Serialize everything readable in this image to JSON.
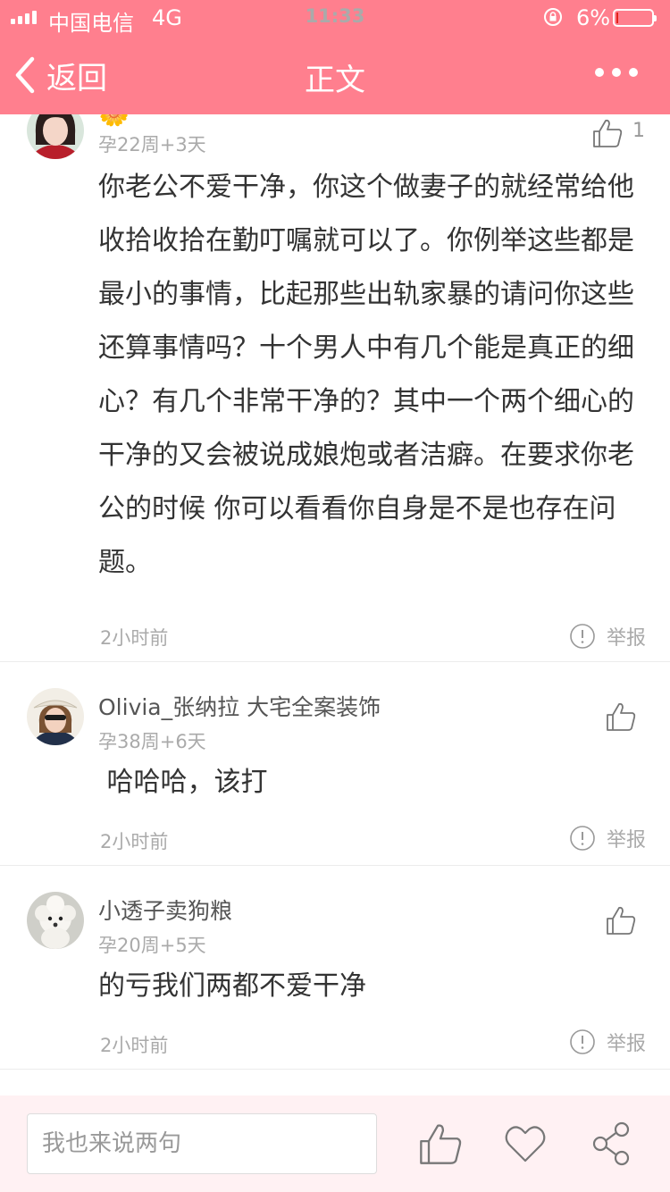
{
  "status": {
    "carrier": "中国电信",
    "network": "4G",
    "time": "11:33",
    "battery": "6%",
    "battery_level": 0.06,
    "battery_color": "#e2231a"
  },
  "nav": {
    "back_label": "返回",
    "title": "正文",
    "accent": "#ff7f8e"
  },
  "comments": [
    {
      "username": "🌼",
      "week": "孕22周+3天",
      "likes": "1",
      "text": "你老公不爱干净，你这个做妻子的就经常给他收拾收拾在勤叮嘱就可以了。你例举这些都是最小的事情，比起那些出轨家暴的请问你这些还算事情吗？十个男人中有几个能是真正的细心？有几个非常干净的？其中一个两个细心的 干净的又会被说成娘炮或者洁癖。在要求你老公的时候 你可以看看你自身是不是也存在问题。",
      "time": "2小时前",
      "report": "举报"
    },
    {
      "username": "Olivia_张纳拉 大宅全案装饰",
      "week": "孕38周+6天",
      "text": " 哈哈哈，该打",
      "time": "2小时前",
      "report": "举报"
    },
    {
      "username": "小透子卖狗粮",
      "week": "孕20周+5天",
      "text": "的亏我们两都不爱干净",
      "time": "2小时前",
      "report": "举报"
    }
  ],
  "footer": {
    "input_placeholder": "我也来说两句"
  }
}
